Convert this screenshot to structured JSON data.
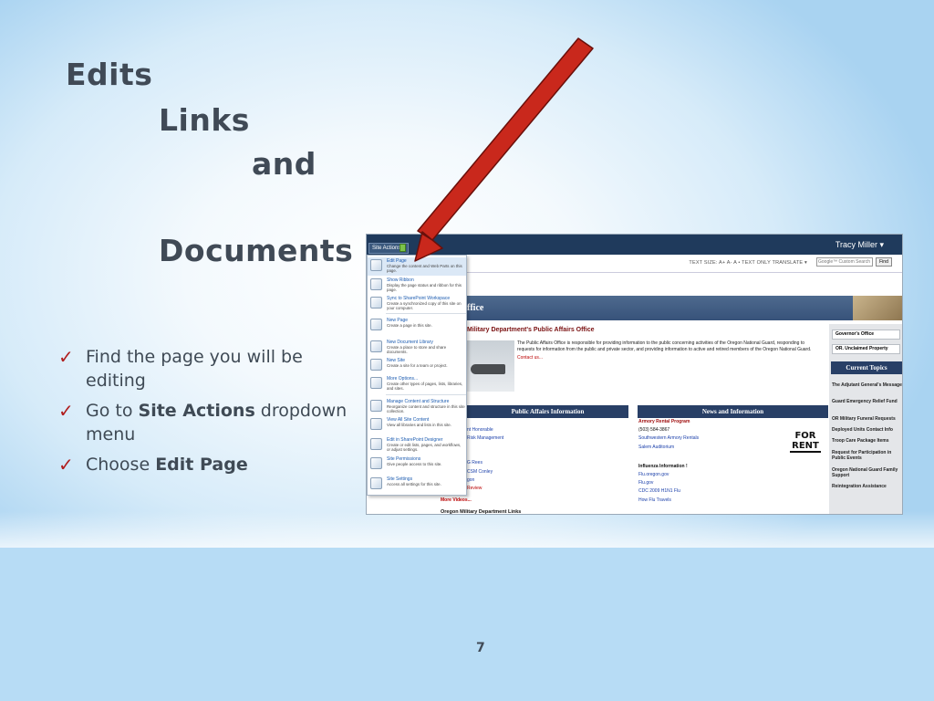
{
  "slide": {
    "title_lines": [
      "Edits",
      "Links",
      "and",
      "Documents"
    ],
    "bullets": [
      {
        "text": "Find the page you will be editing",
        "bold": ""
      },
      {
        "pre": "Go to ",
        "bold": "Site Actions",
        "post": " dropdown menu"
      },
      {
        "pre": "Choose ",
        "bold": "Edit Page",
        "post": ""
      }
    ],
    "page_number": "7",
    "arrow_color": "#c9281c"
  },
  "screenshot": {
    "site_actions_label": "Site Actions ▾",
    "user_name": "Tracy Miller ▾",
    "tools_text": "TEXT SIZE: A+ A- A  •  TEXT ONLY  TRANSLATE ▾",
    "search_placeholder": "Google™ Custom Search",
    "find_label": "Find",
    "title_fragment": "ffice",
    "heading": "Military Department's Public Affairs Office",
    "body_text": "The Public Affairs Office is responsible for providing information to the public concerning activities of the Oregon National Guard, responding to requests for information from the public and private sector, and providing information to active and retired members of the Oregon National Guard.",
    "contact": "Contact us...",
    "pai_header": "Public Affairs Information",
    "nai_header": "News and Information",
    "pai_links": [
      "nt Honorable",
      "Risk Management",
      "",
      "",
      "G Rees",
      "CSM Conley",
      "gon",
      "Review"
    ],
    "news": {
      "heading": "Armory Rental Program",
      "lines": [
        "(503) 584-3867",
        "Southwestern Armory Rentals",
        "Salem Auditorium"
      ],
      "flu_heading": "Influenza Information !",
      "flu_lines": [
        "Flu.oregon.gov",
        "Flu.gov",
        "CDC 2009 H1N1 Flu",
        "How Flu Travels"
      ]
    },
    "for_rent": "FOR RENT",
    "more_videos": "More Videos...",
    "links_title": "Oregon Military Department Links",
    "sidebar_buttons": [
      "Governor's Office",
      "OR. Unclaimed Property"
    ],
    "current_topics": "Current Topics",
    "topics": [
      "The Adjutant General's Message",
      "Guard Emergency Relief Fund",
      "OR Military Funeral Requests",
      "Deployed Units Contact Info",
      "Troop Care Package Items",
      "Request for Participation in Public Events",
      "Oregon National Guard Family Support",
      "Reintegration Assistance"
    ],
    "menu": [
      {
        "label": "Edit Page",
        "desc": "Change the content and Web Parts on this page.",
        "icon": "pencil-page-icon"
      },
      {
        "label": "Show Ribbon",
        "desc": "Display the page status and ribbon for this page.",
        "icon": "ribbon-icon"
      },
      {
        "label": "Sync to SharePoint Workspace",
        "desc": "Create a synchronized copy of this site on your computer.",
        "icon": "sharepoint-workspace-icon"
      },
      {
        "label": "New Page",
        "desc": "Create a page in this site.",
        "icon": "new-page-icon"
      },
      {
        "label": "New Document Library",
        "desc": "Create a place to store and share documents.",
        "icon": "document-library-icon"
      },
      {
        "label": "New Site",
        "desc": "Create a site for a team or project.",
        "icon": "new-site-icon"
      },
      {
        "label": "More Options...",
        "desc": "Create other types of pages, lists, libraries, and sites.",
        "icon": "more-options-icon"
      },
      {
        "label": "Manage Content and Structure",
        "desc": "Reorganize content and structure in this site collection.",
        "icon": "manage-content-icon"
      },
      {
        "label": "View All Site Content",
        "desc": "View all libraries and lists in this site.",
        "icon": "site-content-icon"
      },
      {
        "label": "Edit in SharePoint Designer",
        "desc": "Create or edit lists, pages, and workflows, or adjust settings.",
        "icon": "designer-icon"
      },
      {
        "label": "Site Permissions",
        "desc": "Give people access to this site.",
        "icon": "permissions-icon"
      },
      {
        "label": "Site Settings",
        "desc": "Access all settings for this site.",
        "icon": "settings-icon"
      }
    ]
  }
}
